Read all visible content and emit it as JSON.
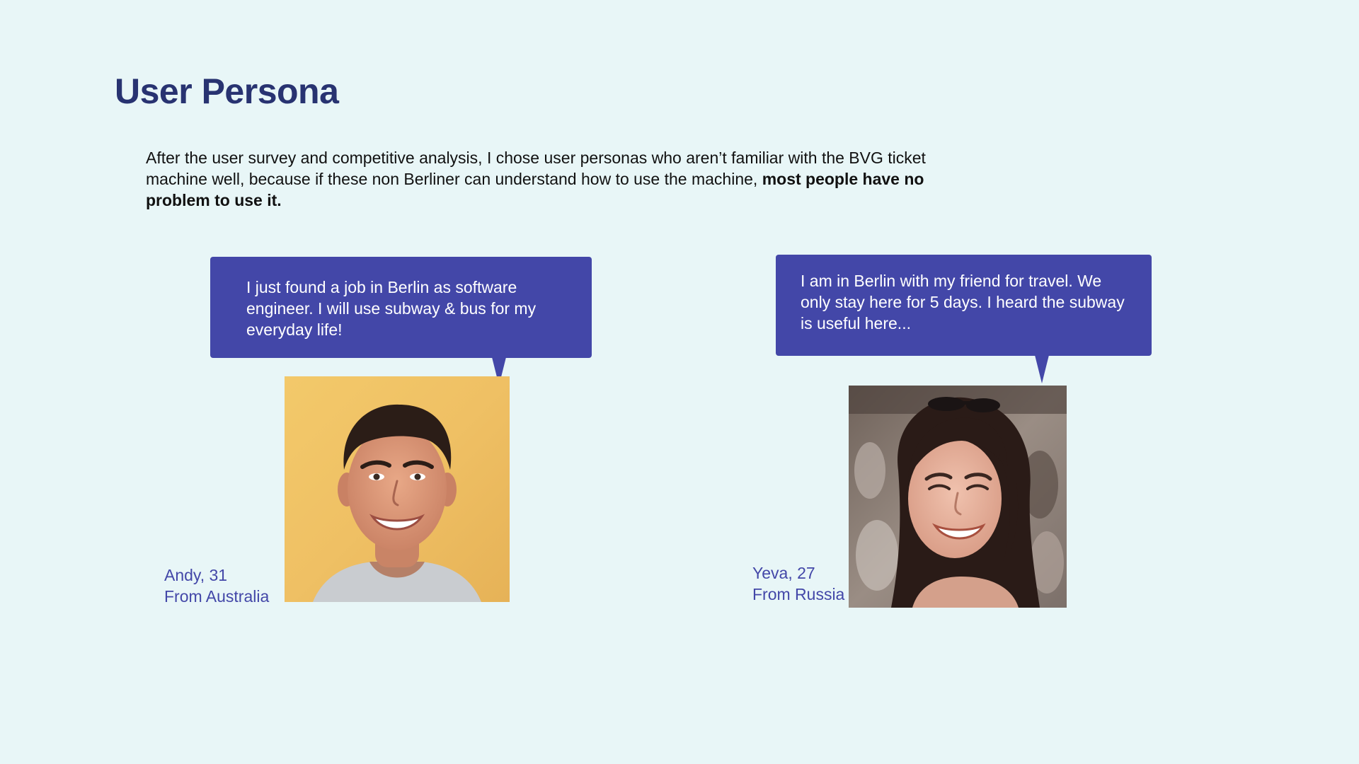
{
  "page": {
    "title": "User Persona",
    "intro_text": "After the user survey and competitive analysis, I chose user personas who aren’t familiar with the BVG ticket machine well, because if these non Berliner can understand how to use the machine, ",
    "intro_bold": "most people have no problem to use it."
  },
  "personas": [
    {
      "quote": "I just found a job in Berlin as software engineer. I will use subway & bus for my everyday life!",
      "name_age": "Andy, 31",
      "origin": "From Australia",
      "photo_icon": "smiling-man-portrait"
    },
    {
      "quote": "I am in Berlin with my friend  for travel. We only stay here for 5 days. I heard the subway is useful here...",
      "name_age": "Yeva, 27",
      "origin": "From Russia",
      "photo_icon": "smiling-woman-portrait"
    }
  ],
  "colors": {
    "background": "#e8f6f7",
    "title": "#283371",
    "accent": "#4347a8",
    "body_text": "#111111"
  }
}
